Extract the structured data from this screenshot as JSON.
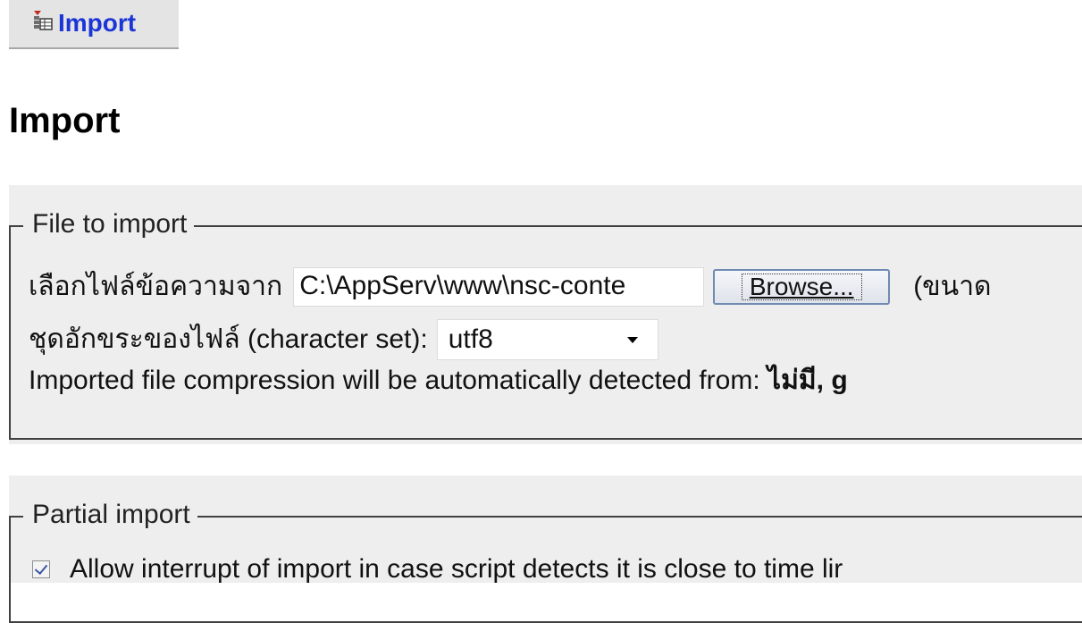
{
  "tab": {
    "label": "Import",
    "icon": "import-icon"
  },
  "page": {
    "title": "Import"
  },
  "file_section": {
    "legend": "File to import",
    "file_label": "เลือกไฟล์ข้อความจาก",
    "file_value": "C:\\AppServ\\www\\nsc-conte",
    "browse_label": "Browse...",
    "size_note": "(ขนาด",
    "charset_label": "ชุดอักขระของไฟล์ (character set):",
    "charset_value": "utf8",
    "compression_text": "Imported file compression will be automatically detected from:",
    "compression_value": "ไม่มี, g"
  },
  "partial_section": {
    "legend": "Partial import",
    "allow_interrupt_label": "Allow interrupt of import in case script detects it is close to time lir",
    "allow_interrupt_checked": true
  },
  "colors": {
    "tab_link": "#1b35d6",
    "panel_bg": "#eeeeee",
    "fieldset_border": "#404040",
    "browse_border": "#6f8ab3"
  }
}
